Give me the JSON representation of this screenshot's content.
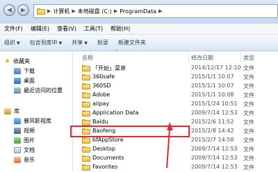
{
  "address": {
    "crumbs": [
      "计算机",
      "本地磁盘 (C:)",
      "ProgramData"
    ]
  },
  "menu": [
    "文件(F)",
    "编辑(E)",
    "查看(V)",
    "工具(T)",
    "帮助(H)"
  ],
  "toolbar": {
    "organize": "组织",
    "include_library": "包含到库中",
    "share": "共享",
    "burn": "刻录",
    "new_folder": "新建文件夹",
    "dropdown_arrow": "▼"
  },
  "nav": {
    "favorites": "收藏夹",
    "favorites_items": [
      "下载",
      "桌面",
      "最近访问的位置"
    ],
    "library": "库",
    "library_items": [
      "暴风影视库",
      "视频",
      "图片",
      "文档",
      "音乐"
    ]
  },
  "columns": {
    "name": "名称",
    "date": "修改日期",
    "type": "类型",
    "sort_arrow": "^"
  },
  "rows": [
    {
      "name": "「开始」菜单",
      "date": "2014/12/17 12:10",
      "type": "文件"
    },
    {
      "name": "360safe",
      "date": "2015/1/1 10:07",
      "type": "文件"
    },
    {
      "name": "360SD",
      "date": "2015/1/1 10:07",
      "type": "文件"
    },
    {
      "name": "Adobe",
      "date": "2015/1/1 10:08",
      "type": "文件"
    },
    {
      "name": "alipay",
      "date": "2015/1/24 10:51",
      "type": "文件"
    },
    {
      "name": "Application Data",
      "date": "2009/7/14 12:53",
      "type": "文件"
    },
    {
      "name": "Baidu",
      "date": "2015/2/6 11:52",
      "type": "文件"
    },
    {
      "name": "Baofeng",
      "date": "2015/2/8 14:42",
      "type": "文件"
    },
    {
      "name": "bfAppStore",
      "date": "2015/2/7 14:58",
      "type": "文件"
    },
    {
      "name": "Desktop",
      "date": "2009/7/14 12:53",
      "type": "文件"
    },
    {
      "name": "Documents",
      "date": "2009/7/14 12:53",
      "type": "文件"
    },
    {
      "name": "Favorites",
      "date": "2009/7/14 12:53",
      "type": "文件"
    }
  ],
  "colors": {
    "folder": "#f2c24a",
    "highlight": "#e8242e",
    "star": "#f5b800"
  }
}
